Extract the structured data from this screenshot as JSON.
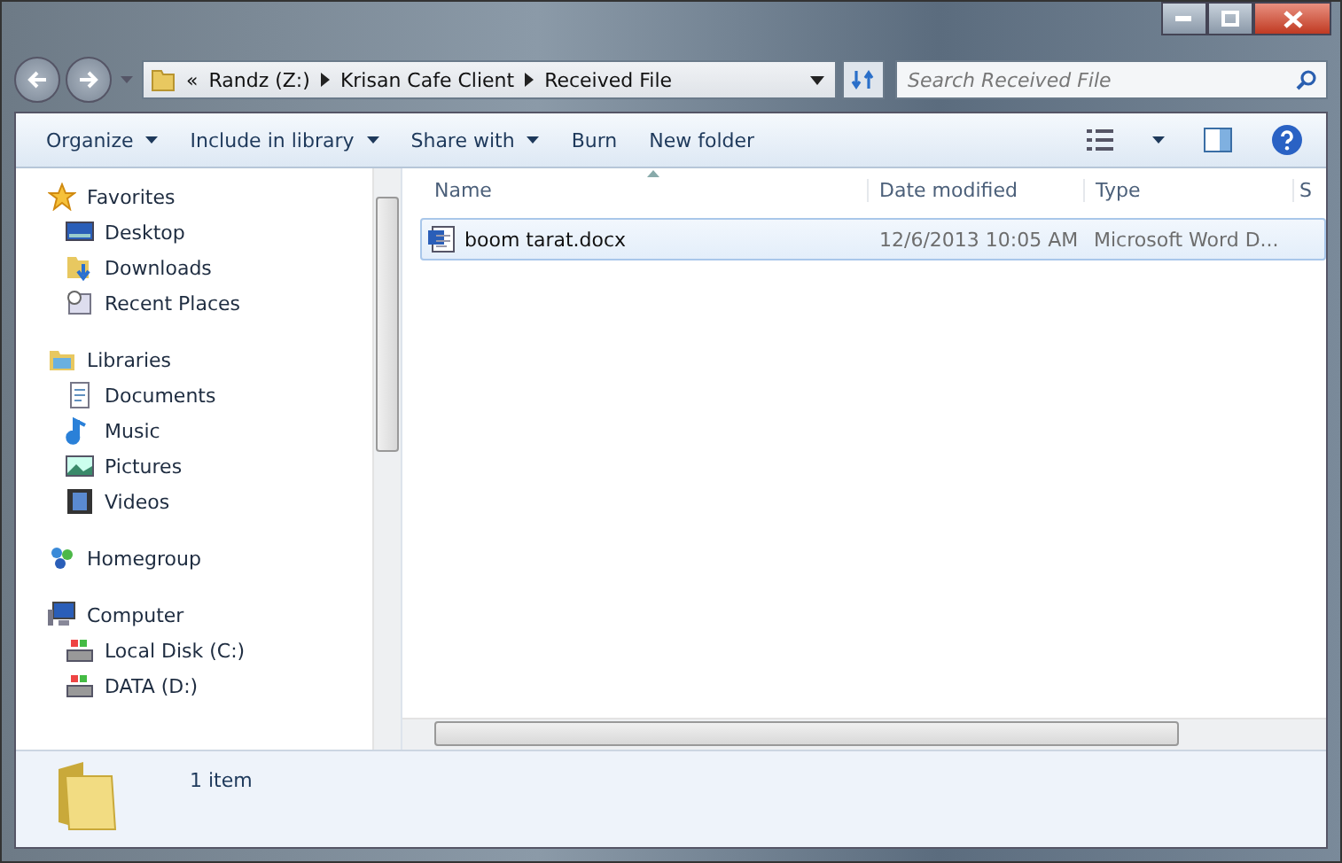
{
  "address_bar": {
    "crumbs": [
      "«",
      "Randz (Z:)",
      "Krisan Cafe Client",
      "Received File"
    ]
  },
  "search": {
    "placeholder": "Search Received File"
  },
  "toolbar": {
    "items": [
      {
        "label": "Organize",
        "dropdown": true
      },
      {
        "label": "Include in library",
        "dropdown": true
      },
      {
        "label": "Share with",
        "dropdown": true
      },
      {
        "label": "Burn",
        "dropdown": false
      },
      {
        "label": "New folder",
        "dropdown": false
      }
    ]
  },
  "sidebar": {
    "groups": [
      {
        "label": "Favorites",
        "children": [
          {
            "label": "Desktop"
          },
          {
            "label": "Downloads"
          },
          {
            "label": "Recent Places"
          }
        ]
      },
      {
        "label": "Libraries",
        "children": [
          {
            "label": "Documents"
          },
          {
            "label": "Music"
          },
          {
            "label": "Pictures"
          },
          {
            "label": "Videos"
          }
        ]
      },
      {
        "label": "Homegroup"
      },
      {
        "label": "Computer",
        "children": [
          {
            "label": "Local Disk (C:)"
          },
          {
            "label": "DATA (D:)"
          }
        ]
      }
    ]
  },
  "table": {
    "columns": [
      "Name",
      "Date modified",
      "Type",
      "S"
    ],
    "rows": [
      {
        "name": "boom tarat.docx",
        "date": "12/6/2013 10:05 AM",
        "type": "Microsoft Word D...",
        "selected": true
      }
    ]
  },
  "status_bar": {
    "text": "1 item"
  }
}
